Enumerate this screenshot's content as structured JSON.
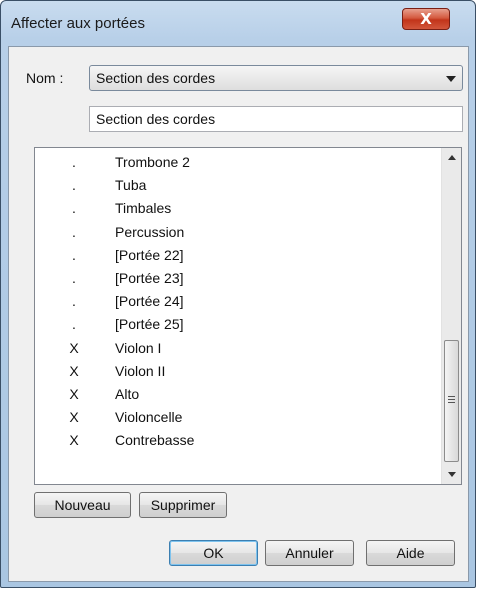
{
  "window": {
    "title": "Affecter aux portées"
  },
  "form": {
    "nom_label": "Nom :",
    "nom_selected": "Section des cordes",
    "name_field_value": "Section des cordes"
  },
  "staves": [
    {
      "mark": ".",
      "name": "Trombone 2"
    },
    {
      "mark": ".",
      "name": "Tuba"
    },
    {
      "mark": ".",
      "name": "Timbales"
    },
    {
      "mark": ".",
      "name": "Percussion"
    },
    {
      "mark": ".",
      "name": "[Portée 22]"
    },
    {
      "mark": ".",
      "name": "[Portée 23]"
    },
    {
      "mark": ".",
      "name": "[Portée 24]"
    },
    {
      "mark": ".",
      "name": "[Portée 25]"
    },
    {
      "mark": "X",
      "name": "Violon I"
    },
    {
      "mark": "X",
      "name": "Violon II"
    },
    {
      "mark": "X",
      "name": "Alto"
    },
    {
      "mark": "X",
      "name": "Violoncelle"
    },
    {
      "mark": "X",
      "name": "Contrebasse"
    }
  ],
  "buttons": {
    "close": "X",
    "nouveau": "Nouveau",
    "supprimer": "Supprimer",
    "ok": "OK",
    "annuler": "Annuler",
    "aide": "Aide"
  },
  "colors": {
    "close_button": "#c2341a",
    "default_button_border": "#3c7fb1",
    "title_bar": "#b7cfe8"
  }
}
